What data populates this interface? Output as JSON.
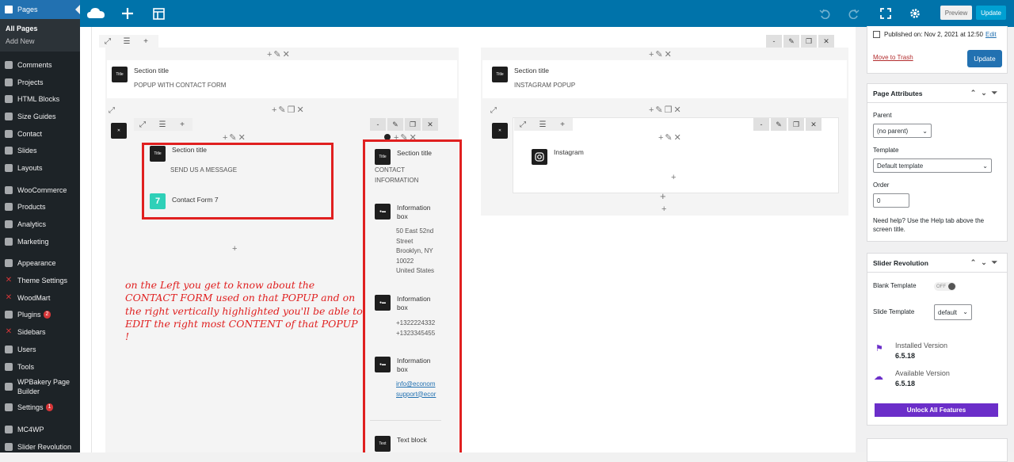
{
  "sidebar": {
    "pages_label": "Pages",
    "sub": [
      "All Pages",
      "Add New"
    ],
    "items": [
      {
        "label": "Comments",
        "icon": "comments-icon"
      },
      {
        "label": "Projects",
        "icon": "projects-icon"
      },
      {
        "label": "HTML Blocks",
        "icon": "html-blocks-icon"
      },
      {
        "label": "Size Guides",
        "icon": "size-guides-icon"
      },
      {
        "label": "Contact",
        "icon": "contact-icon"
      },
      {
        "label": "Slides",
        "icon": "slides-icon"
      },
      {
        "label": "Layouts",
        "icon": "layouts-icon"
      },
      {
        "label": "WooCommerce",
        "icon": "woocommerce-icon"
      },
      {
        "label": "Products",
        "icon": "products-icon"
      },
      {
        "label": "Analytics",
        "icon": "analytics-icon"
      },
      {
        "label": "Marketing",
        "icon": "marketing-icon"
      },
      {
        "label": "Appearance",
        "icon": "appearance-icon"
      },
      {
        "label": "Theme Settings",
        "icon": "theme-settings-icon"
      },
      {
        "label": "WoodMart",
        "icon": "woodmart-icon"
      },
      {
        "label": "Plugins",
        "icon": "plugins-icon",
        "badge": "2"
      },
      {
        "label": "Sidebars",
        "icon": "sidebars-icon"
      },
      {
        "label": "Users",
        "icon": "users-icon"
      },
      {
        "label": "Tools",
        "icon": "tools-icon"
      },
      {
        "label": "WPBakery Page Builder",
        "icon": "wpbakery-icon"
      },
      {
        "label": "Settings",
        "icon": "settings-icon",
        "badge": "1"
      },
      {
        "label": "MC4WP",
        "icon": "mc4wp-icon"
      },
      {
        "label": "Slider Revolution",
        "icon": "slider-revolution-icon"
      }
    ]
  },
  "topbar": {
    "preview_label": "Preview",
    "update_label": "Update"
  },
  "editor": {
    "col_left": {
      "section_label": "Section title",
      "section_text": "POPUP WITH CONTACT FORM",
      "inner_left": {
        "section_label": "Section title",
        "section_text": "SEND US A MESSAGE",
        "form_label": "Contact Form 7",
        "form_icon_text": "7"
      },
      "inner_right": {
        "section_label": "Section title",
        "section_text": "CONTACT INFORMATION",
        "info1_label": "Information box",
        "info1_lines": [
          "50 East 52nd",
          "Street",
          "Brooklyn, NY",
          "10022",
          "United States"
        ],
        "info2_label": "Information box",
        "info2_lines": [
          "+1322224332",
          "+1323345455"
        ],
        "info3_label": "Information box",
        "info3_lines": [
          "info@econom",
          "support@ecor"
        ],
        "text_block_label": "Text block"
      }
    },
    "col_right": {
      "section_label": "Section title",
      "section_text": "INSTAGRAM POPUP",
      "instagram_label": "Instagram"
    },
    "icon_title_text": "Title",
    "annotation": "on the Left you get to know about the CONTACT FORM used on that POPUP and on the right vertically highlighted you'll be able to EDIT the right most CONTENT of that POPUP !"
  },
  "right_panel": {
    "published_label": "Published on: Nov 2, 2021 at 12:50",
    "edit_link": "Edit",
    "trash_link": "Move to Trash",
    "update_button": "Update",
    "page_attributes": {
      "title": "Page Attributes",
      "parent_label": "Parent",
      "parent_value": "(no parent)",
      "template_label": "Template",
      "template_value": "Default template",
      "order_label": "Order",
      "order_value": "0",
      "help_text": "Need help? Use the Help tab above the screen title."
    },
    "slider_revolution": {
      "title": "Slider Revolution",
      "blank_template_label": "Blank Template",
      "toggle_label": "OFF",
      "slide_template_label": "Slide Template",
      "slide_template_value": "default",
      "installed_label": "Installed Version",
      "installed_value": "6.5.18",
      "available_label": "Available Version",
      "available_value": "6.5.18",
      "unlock_button": "Unlock All Features"
    }
  },
  "colors": {
    "topbar": "#0073aa",
    "sidebar": "#1d2327",
    "accent": "#2271b1",
    "highlight": "#e02020",
    "unlock": "#6b2ec9"
  }
}
